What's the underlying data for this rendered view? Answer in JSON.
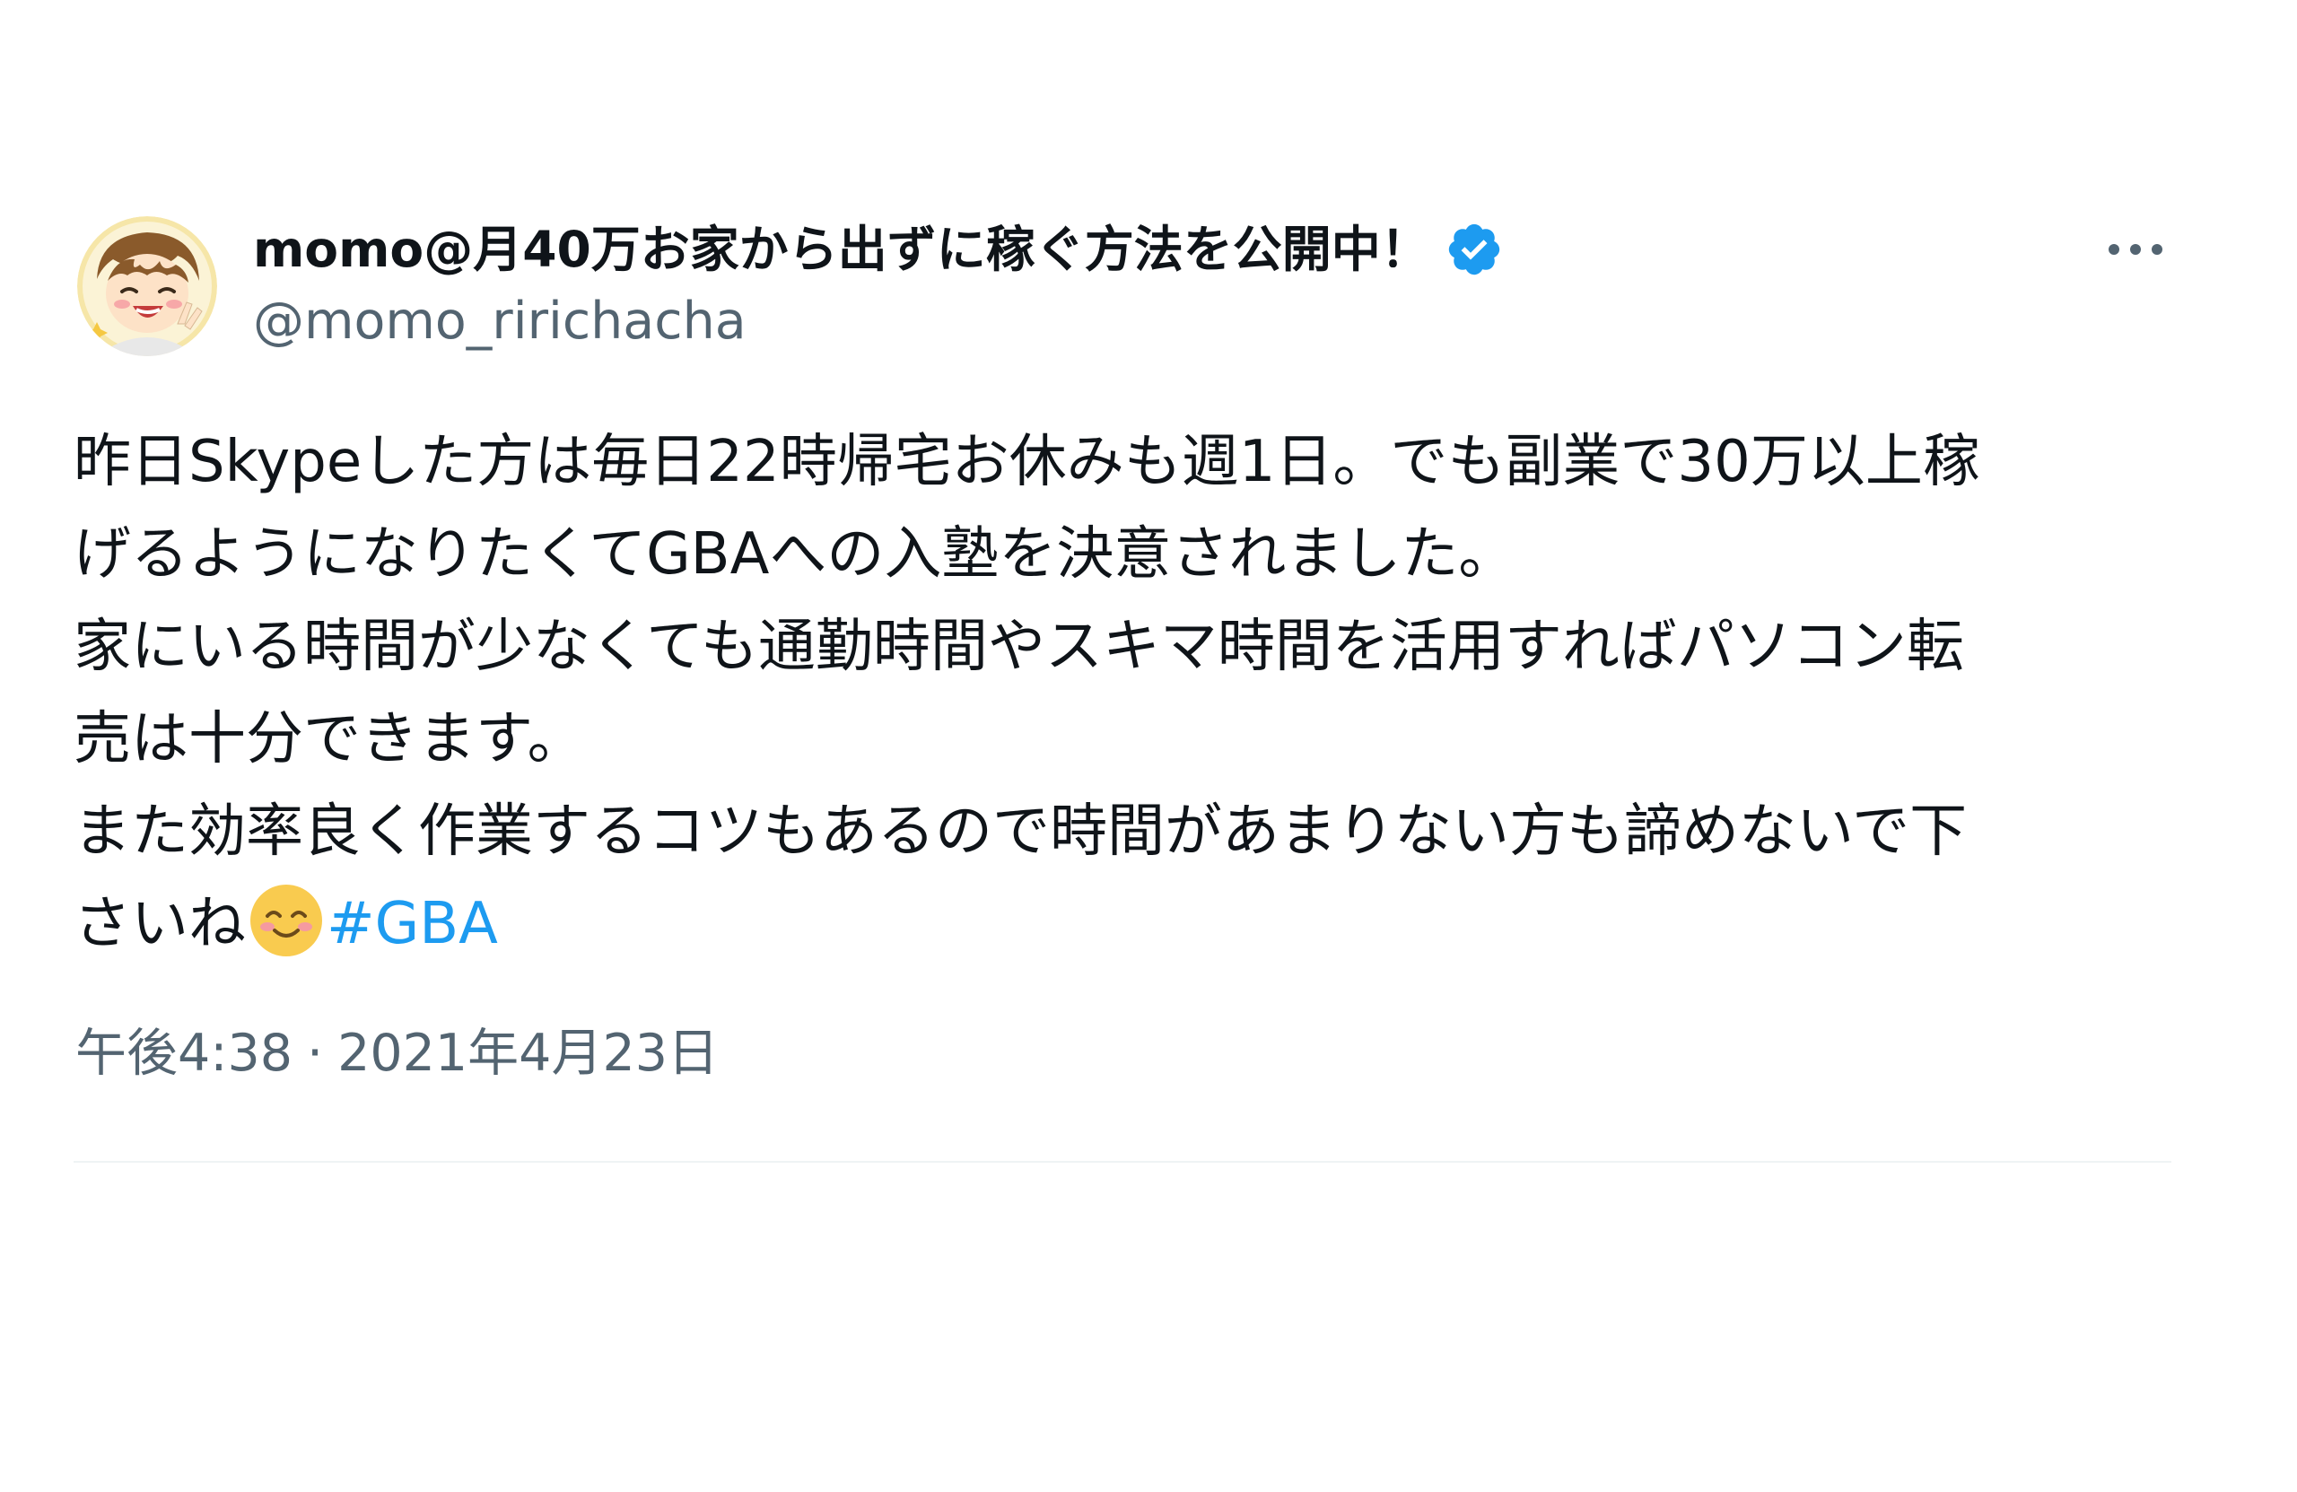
{
  "tweet": {
    "author": {
      "display_name": "momo@月40万お家から出ずに稼ぐ方法を公開中！",
      "handle": "@momo_ririchacha",
      "verified": true,
      "avatar_icon": "cartoon-avatar"
    },
    "more_icon": "more-options-icon",
    "body_lines": [
      "昨日Skypeした方は毎日22時帰宅お休みも週1日。でも副業で30万以上稼",
      "げるようになりたくてGBAへの入塾を決意されました。",
      "家にいる時間が少なくても通勤時間やスキマ時間を活用すればパソコン転",
      "売は十分できます。",
      "また効率良く作業するコツもあるので時間があまりない方も諦めないで下"
    ],
    "last_line_text": "さいね",
    "emoji": "smiling-face-emoji",
    "hashtag": "#GBA",
    "time": "午後4:38",
    "separator": "·",
    "date": "2021年4月23日"
  },
  "colors": {
    "text": "#0f1419",
    "secondary": "#536471",
    "link": "#1d9bf0",
    "verified": "#1d9bf0",
    "divider": "#eff3f4"
  }
}
